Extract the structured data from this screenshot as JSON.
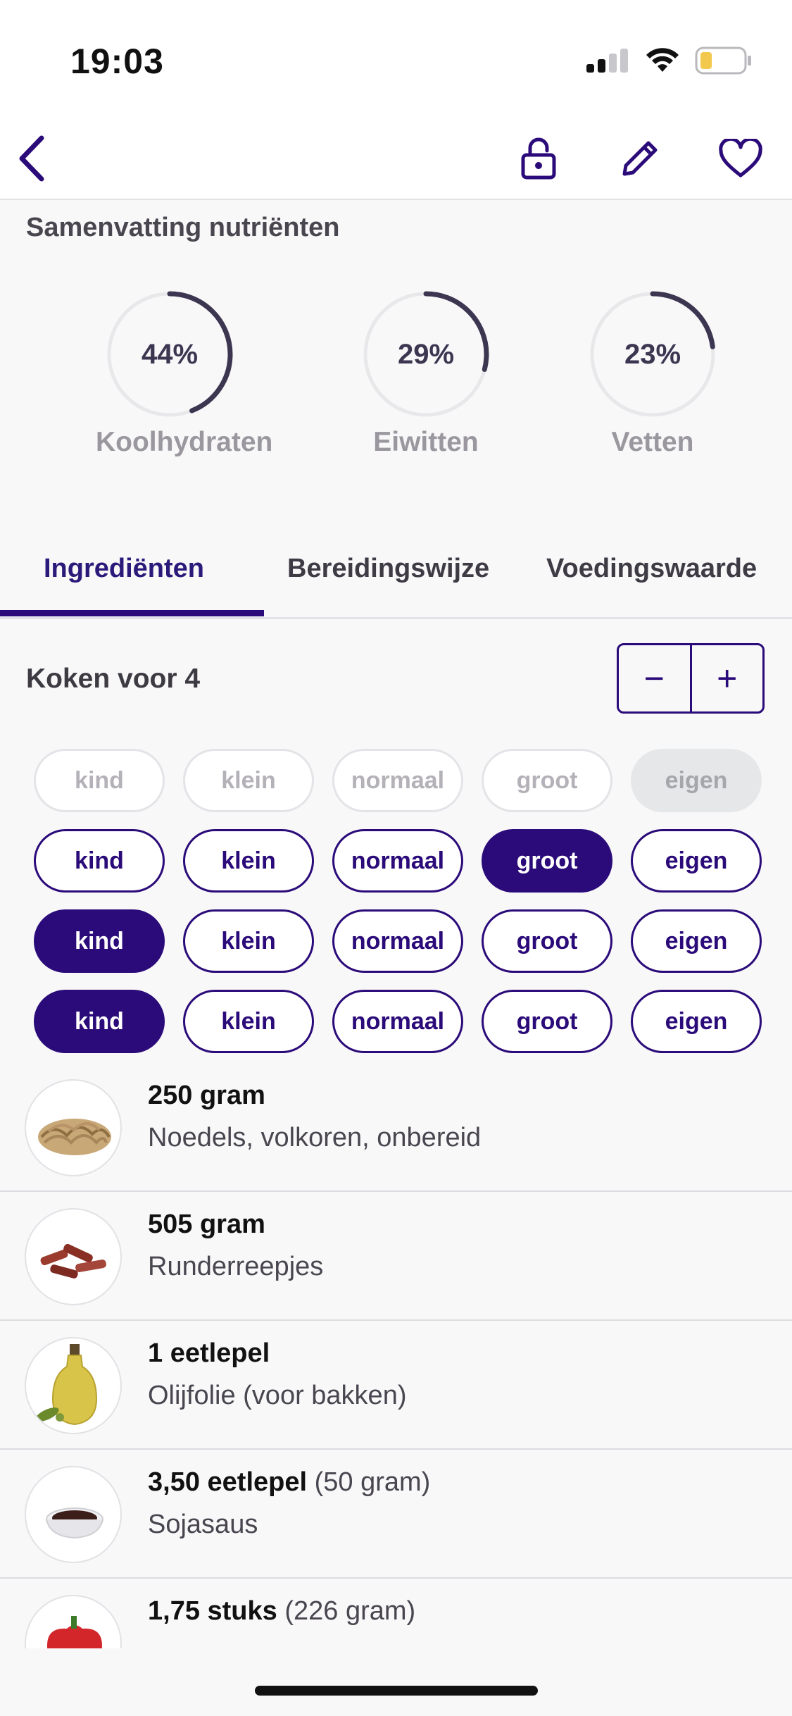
{
  "status_bar": {
    "time": "19:03"
  },
  "nav": {
    "back_icon": "chevron-left-icon",
    "lock_icon": "lock-icon",
    "edit_icon": "pencil-icon",
    "favorite_icon": "heart-icon"
  },
  "summary": {
    "title": "Samenvatting nutriënten",
    "rings": [
      {
        "percent_text": "44%",
        "value": 0.44,
        "label": "Koolhydraten"
      },
      {
        "percent_text": "29%",
        "value": 0.29,
        "label": "Eiwitten"
      },
      {
        "percent_text": "23%",
        "value": 0.23,
        "label": "Vetten"
      }
    ]
  },
  "tabs": [
    {
      "label": "Ingrediënten",
      "active": true
    },
    {
      "label": "Bereidingswijze",
      "active": false
    },
    {
      "label": "Voedingswaarde",
      "active": false
    }
  ],
  "servings": {
    "label": "Koken voor 4",
    "minus": "−",
    "plus": "+"
  },
  "portion_rows": [
    [
      {
        "label": "kind",
        "state": "disabled"
      },
      {
        "label": "klein",
        "state": "disabled"
      },
      {
        "label": "normaal",
        "state": "disabled"
      },
      {
        "label": "groot",
        "state": "disabled"
      },
      {
        "label": "eigen",
        "state": "disabled-filled"
      }
    ],
    [
      {
        "label": "kind",
        "state": "default"
      },
      {
        "label": "klein",
        "state": "default"
      },
      {
        "label": "normaal",
        "state": "default"
      },
      {
        "label": "groot",
        "state": "selected"
      },
      {
        "label": "eigen",
        "state": "default"
      }
    ],
    [
      {
        "label": "kind",
        "state": "selected"
      },
      {
        "label": "klein",
        "state": "default"
      },
      {
        "label": "normaal",
        "state": "default"
      },
      {
        "label": "groot",
        "state": "default"
      },
      {
        "label": "eigen",
        "state": "default"
      }
    ],
    [
      {
        "label": "kind",
        "state": "selected"
      },
      {
        "label": "klein",
        "state": "default"
      },
      {
        "label": "normaal",
        "state": "default"
      },
      {
        "label": "groot",
        "state": "default"
      },
      {
        "label": "eigen",
        "state": "default"
      }
    ]
  ],
  "ingredients": [
    {
      "amount": "250 gram",
      "extra": "",
      "name": "Noedels, volkoren, onbereid",
      "image": "noodles-image"
    },
    {
      "amount": "505 gram",
      "extra": "",
      "name": "Runderreepjes",
      "image": "beef-strips-image"
    },
    {
      "amount": "1 eetlepel",
      "extra": "",
      "name": "Olijfolie (voor bakken)",
      "image": "olive-oil-image"
    },
    {
      "amount": "3,50 eetlepel",
      "extra": "(50 gram)",
      "name": "Sojasaus",
      "image": "soy-sauce-image"
    },
    {
      "amount": "1,75 stuks",
      "extra": "(226 gram)",
      "name": "",
      "image": "red-pepper-image"
    }
  ],
  "colors": {
    "accent": "#2b0b79",
    "ring_track": "#e8e7ea",
    "ring_fill": "#3d3651"
  }
}
